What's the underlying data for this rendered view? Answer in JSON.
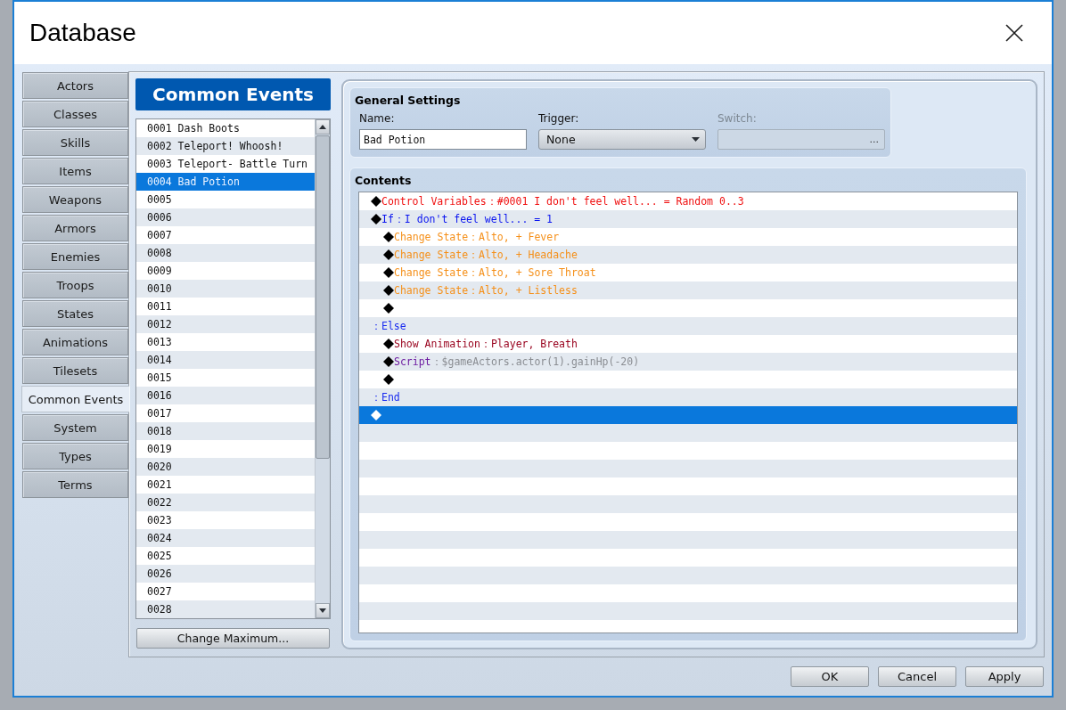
{
  "window": {
    "title": "Database"
  },
  "tabs": [
    {
      "label": "Actors",
      "selected": false
    },
    {
      "label": "Classes",
      "selected": false
    },
    {
      "label": "Skills",
      "selected": false
    },
    {
      "label": "Items",
      "selected": false
    },
    {
      "label": "Weapons",
      "selected": false
    },
    {
      "label": "Armors",
      "selected": false
    },
    {
      "label": "Enemies",
      "selected": false
    },
    {
      "label": "Troops",
      "selected": false
    },
    {
      "label": "States",
      "selected": false
    },
    {
      "label": "Animations",
      "selected": false
    },
    {
      "label": "Tilesets",
      "selected": false
    },
    {
      "label": "Common Events",
      "selected": true
    },
    {
      "label": "System",
      "selected": false
    },
    {
      "label": "Types",
      "selected": false
    },
    {
      "label": "Terms",
      "selected": false
    }
  ],
  "common_events": {
    "title": "Common Events",
    "items": [
      {
        "label": "0001 Dash Boots",
        "selected": false
      },
      {
        "label": "0002 Teleport! Whoosh!",
        "selected": false
      },
      {
        "label": "0003 Teleport- Battle Turn",
        "selected": false
      },
      {
        "label": "0004 Bad Potion",
        "selected": true
      },
      {
        "label": "0005",
        "selected": false
      },
      {
        "label": "0006",
        "selected": false
      },
      {
        "label": "0007",
        "selected": false
      },
      {
        "label": "0008",
        "selected": false
      },
      {
        "label": "0009",
        "selected": false
      },
      {
        "label": "0010",
        "selected": false
      },
      {
        "label": "0011",
        "selected": false
      },
      {
        "label": "0012",
        "selected": false
      },
      {
        "label": "0013",
        "selected": false
      },
      {
        "label": "0014",
        "selected": false
      },
      {
        "label": "0015",
        "selected": false
      },
      {
        "label": "0016",
        "selected": false
      },
      {
        "label": "0017",
        "selected": false
      },
      {
        "label": "0018",
        "selected": false
      },
      {
        "label": "0019",
        "selected": false
      },
      {
        "label": "0020",
        "selected": false
      },
      {
        "label": "0021",
        "selected": false
      },
      {
        "label": "0022",
        "selected": false
      },
      {
        "label": "0023",
        "selected": false
      },
      {
        "label": "0024",
        "selected": false
      },
      {
        "label": "0025",
        "selected": false
      },
      {
        "label": "0026",
        "selected": false
      },
      {
        "label": "0027",
        "selected": false
      },
      {
        "label": "0028",
        "selected": false
      }
    ],
    "change_maximum_button": "Change Maximum..."
  },
  "general_settings": {
    "title": "General Settings",
    "name": {
      "label": "Name:",
      "value": "Bad Potion"
    },
    "trigger": {
      "label": "Trigger:",
      "value": "None"
    },
    "switch": {
      "label": "Switch:",
      "disabled": true,
      "button": "..."
    }
  },
  "contents": {
    "title": "Contents",
    "commands": [
      {
        "kind": "control_variables",
        "command": "Control Variables",
        "params": "：#0001 I don't feel well... = Random 0..3",
        "selected": false
      },
      {
        "kind": "conditional",
        "command": "If",
        "params": "：I don't feel well... = 1",
        "selected": false,
        "children": [
          {
            "kind": "change_state",
            "command": "Change State",
            "params": "：Alto, + Fever",
            "selected": false
          },
          {
            "kind": "change_state",
            "command": "Change State",
            "params": "：Alto, + Headache",
            "selected": false
          },
          {
            "kind": "change_state",
            "command": "Change State",
            "params": "：Alto, + Sore Throat",
            "selected": false
          },
          {
            "kind": "change_state",
            "command": "Change State",
            "params": "：Alto, + Listless",
            "selected": false
          },
          {
            "kind": "empty",
            "selected": false
          }
        ]
      },
      {
        "kind": "branch",
        "command": "：Else",
        "selected": false,
        "children": [
          {
            "kind": "show_animation",
            "command": "Show Animation",
            "params": "：Player, Breath",
            "selected": false
          },
          {
            "kind": "script",
            "command": "Script",
            "params": "：$gameActors.actor(1).gainHp(-20)",
            "selected": false
          },
          {
            "kind": "empty",
            "selected": false
          }
        ]
      },
      {
        "kind": "branch",
        "command": "：End",
        "selected": false
      },
      {
        "kind": "empty",
        "selected": true
      }
    ]
  },
  "buttons": [
    "OK",
    "Cancel",
    "Apply"
  ]
}
